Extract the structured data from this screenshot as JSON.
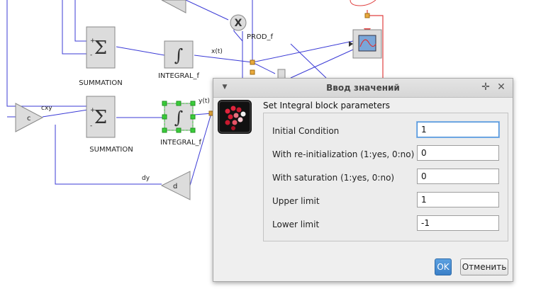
{
  "diagram": {
    "blocks": {
      "summation_top": "SUMMATION",
      "summation_bottom": "SUMMATION",
      "integral_top": "INTEGRAL_f",
      "integral_bottom": "INTEGRAL_f",
      "prod": "PROD_f",
      "gain_c": "c",
      "gain_d": "d"
    },
    "signals": {
      "x": "x(t)",
      "y": "y(t)",
      "cxy": "cxy",
      "dy": "dy"
    },
    "symbols": {
      "sum_sign": "Σ",
      "integral_sign": "∫",
      "prod_sign": "X",
      "plus": "+",
      "minus": "-"
    },
    "colors": {
      "link": "#3b3bd6",
      "event_link": "#e04040",
      "port": "#e8a93c",
      "selection": "#2dbb2d"
    }
  },
  "dialog": {
    "title": "Ввод значений",
    "header": "Set Integral block parameters",
    "params": [
      {
        "label": "Initial Condition",
        "value": "1"
      },
      {
        "label": "With re-initialization (1:yes, 0:no)",
        "value": "0"
      },
      {
        "label": "With saturation (1:yes, 0:no)",
        "value": "0"
      },
      {
        "label": "Upper limit",
        "value": "1"
      },
      {
        "label": "Lower limit",
        "value": "-1"
      }
    ],
    "buttons": {
      "ok": "OK",
      "cancel": "Отменить"
    },
    "icons": {
      "menu": "menu-arrow-icon",
      "pin": "pin-icon",
      "close": "close-icon",
      "logo": "scilab-logo-icon"
    }
  }
}
